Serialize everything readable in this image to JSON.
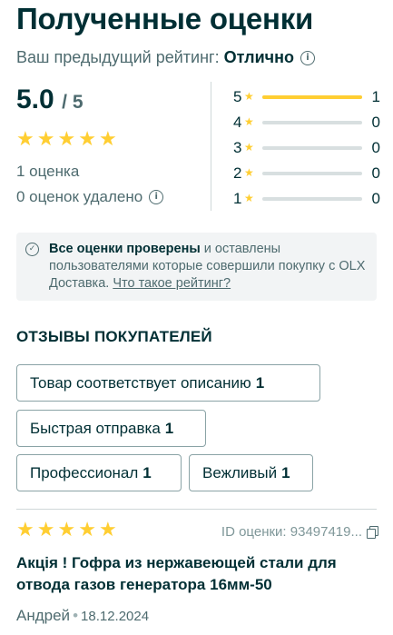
{
  "header": {
    "title": "Полученные оценки",
    "previous_rating_label": "Ваш предыдущий рейтинг:",
    "previous_rating_value": "Отлично",
    "info_icon": "info-icon"
  },
  "summary": {
    "score": "5.0",
    "out_of": "/ 5",
    "stars_filled": 5,
    "ratings_count": "1 оценка",
    "removed_count": "0 оценок удалено"
  },
  "distribution": [
    {
      "stars": "5",
      "count": "1",
      "fraction": 1.0
    },
    {
      "stars": "4",
      "count": "0",
      "fraction": 0.0
    },
    {
      "stars": "3",
      "count": "0",
      "fraction": 0.0
    },
    {
      "stars": "2",
      "count": "0",
      "fraction": 0.0
    },
    {
      "stars": "1",
      "count": "0",
      "fraction": 0.0
    }
  ],
  "notice": {
    "bold": "Все оценки проверены",
    "text": " и оставлены пользователями которые совершили покупку с OLX Доставка. ",
    "link": "Что такое рейтинг?"
  },
  "reviews_section": {
    "title": "ОТЗЫВЫ ПОКУПАТЕЛЕЙ",
    "chips": [
      {
        "label": "Товар соответствует описанию",
        "count": "1"
      },
      {
        "label": "Быстрая отправка",
        "count": "1"
      },
      {
        "label": "Профессионал",
        "count": "1"
      },
      {
        "label": "Вежливый",
        "count": "1"
      }
    ]
  },
  "review": {
    "stars_filled": 5,
    "id_text": "ID оценки: 93497419...",
    "title": "Акція ! Гофра из нержавеющей стали для отвода газов генератора 16мм-50",
    "author": "Андрей",
    "date": "18.12.2024"
  },
  "colors": {
    "star": "#ffce32",
    "text_primary": "#002f34",
    "text_secondary": "#4e6b6f",
    "notice_bg": "#f2f4f5"
  }
}
